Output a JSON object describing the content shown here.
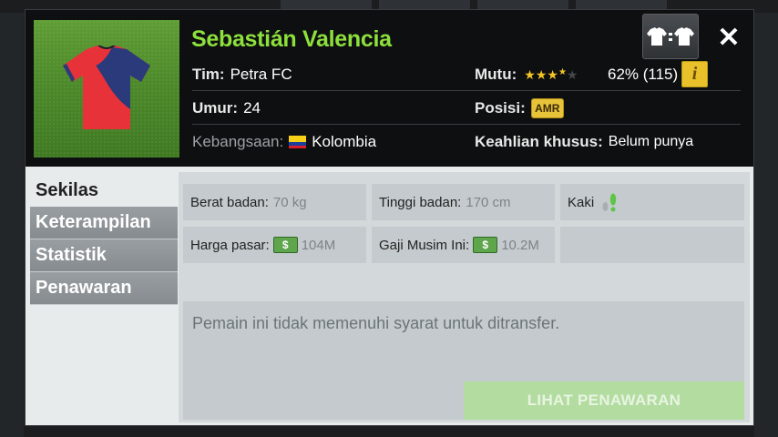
{
  "player": {
    "name": "Sebastián Valencia",
    "team_label": "Tim:",
    "team_value": "Petra FC",
    "age_label": "Umur:",
    "age_value": "24",
    "nationality_label": "Kebangsaan:",
    "nationality_value": "Kolombia",
    "quality_label": "Mutu:",
    "quality_stars": 3.5,
    "quality_value": "62% (115)",
    "info_icon_text": "i",
    "position_label": "Posisi:",
    "position_value": "AMR",
    "specialty_label": "Keahlian khusus:",
    "specialty_value": "Belum punya"
  },
  "header_buttons": {
    "compare_icon": "jersey-compare-icon",
    "compare_text": "⇆",
    "close_icon": "close-icon"
  },
  "tabs": [
    {
      "label": "Sekilas",
      "active": true
    },
    {
      "label": "Keterampilan",
      "active": false
    },
    {
      "label": "Statistik",
      "active": false
    },
    {
      "label": "Penawaran",
      "active": false
    }
  ],
  "overview": {
    "weight_label": "Berat badan:",
    "weight_value": "70 kg",
    "height_label": "Tinggi badan:",
    "height_value": "170 cm",
    "foot_label": "Kaki",
    "market_label": "Harga pasar:",
    "market_value": "104M",
    "wage_label": "Gaji Musim Ini:",
    "wage_value": "10.2M",
    "money_icon_text": "$"
  },
  "transfer": {
    "message": "Pemain ini tidak memenuhi syarat untuk ditransfer.",
    "button_label": "LIHAT PENAWARAN"
  },
  "colors": {
    "name_green": "#8de03c",
    "star_gold": "#f3c628",
    "button_disabled_green": "#b3dca1",
    "jersey_red": "#e8323a",
    "jersey_navy": "#2a3a7a"
  }
}
